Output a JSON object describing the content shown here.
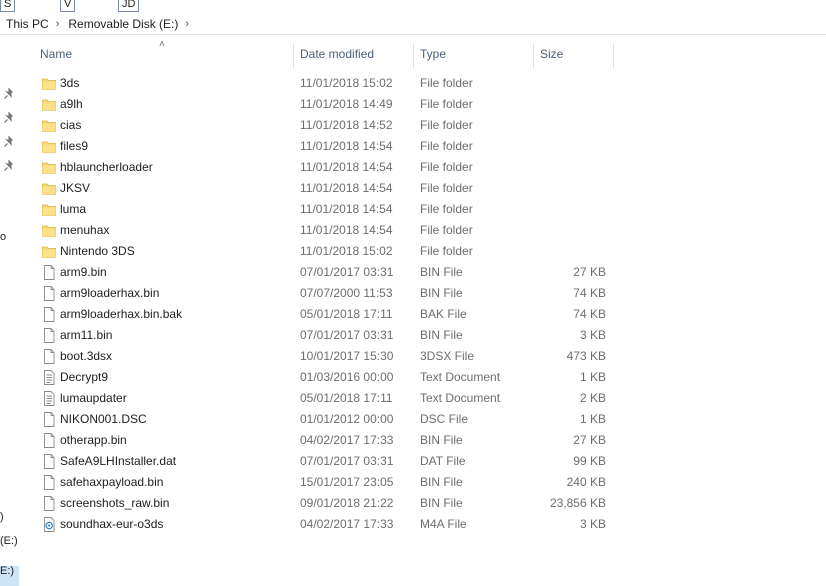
{
  "top_keys": [
    "S",
    "V",
    "JD"
  ],
  "breadcrumb": {
    "items": [
      "This PC",
      "Removable Disk (E:)"
    ]
  },
  "nav_fragments": [
    "o",
    ")",
    "(E:)",
    "E:)"
  ],
  "columns": {
    "name": "Name",
    "date": "Date modified",
    "type": "Type",
    "size": "Size"
  },
  "icons": {
    "folder": "folder-icon",
    "file": "file-icon",
    "text": "text-document-icon",
    "media": "media-file-icon",
    "pin": "pin-icon"
  },
  "colors": {
    "folder": "#f8d775",
    "selection": "#cce4f7",
    "header_text": "#4c607a"
  },
  "files": [
    {
      "name": "3ds",
      "date": "11/01/2018 15:02",
      "type": "File folder",
      "size": "",
      "icon": "folder"
    },
    {
      "name": "a9lh",
      "date": "11/01/2018 14:49",
      "type": "File folder",
      "size": "",
      "icon": "folder"
    },
    {
      "name": "cias",
      "date": "11/01/2018 14:52",
      "type": "File folder",
      "size": "",
      "icon": "folder"
    },
    {
      "name": "files9",
      "date": "11/01/2018 14:54",
      "type": "File folder",
      "size": "",
      "icon": "folder"
    },
    {
      "name": "hblauncherloader",
      "date": "11/01/2018 14:54",
      "type": "File folder",
      "size": "",
      "icon": "folder"
    },
    {
      "name": "JKSV",
      "date": "11/01/2018 14:54",
      "type": "File folder",
      "size": "",
      "icon": "folder"
    },
    {
      "name": "luma",
      "date": "11/01/2018 14:54",
      "type": "File folder",
      "size": "",
      "icon": "folder"
    },
    {
      "name": "menuhax",
      "date": "11/01/2018 14:54",
      "type": "File folder",
      "size": "",
      "icon": "folder"
    },
    {
      "name": "Nintendo 3DS",
      "date": "11/01/2018 15:02",
      "type": "File folder",
      "size": "",
      "icon": "folder"
    },
    {
      "name": "arm9.bin",
      "date": "07/01/2017 03:31",
      "type": "BIN File",
      "size": "27 KB",
      "icon": "file"
    },
    {
      "name": "arm9loaderhax.bin",
      "date": "07/07/2000 11:53",
      "type": "BIN File",
      "size": "74 KB",
      "icon": "file"
    },
    {
      "name": "arm9loaderhax.bin.bak",
      "date": "05/01/2018 17:11",
      "type": "BAK File",
      "size": "74 KB",
      "icon": "file"
    },
    {
      "name": "arm11.bin",
      "date": "07/01/2017 03:31",
      "type": "BIN File",
      "size": "3 KB",
      "icon": "file"
    },
    {
      "name": "boot.3dsx",
      "date": "10/01/2017 15:30",
      "type": "3DSX File",
      "size": "473 KB",
      "icon": "file"
    },
    {
      "name": "Decrypt9",
      "date": "01/03/2016 00:00",
      "type": "Text Document",
      "size": "1 KB",
      "icon": "text"
    },
    {
      "name": "lumaupdater",
      "date": "05/01/2018 17:11",
      "type": "Text Document",
      "size": "2 KB",
      "icon": "text"
    },
    {
      "name": "NIKON001.DSC",
      "date": "01/01/2012 00:00",
      "type": "DSC File",
      "size": "1 KB",
      "icon": "file"
    },
    {
      "name": "otherapp.bin",
      "date": "04/02/2017 17:33",
      "type": "BIN File",
      "size": "27 KB",
      "icon": "file"
    },
    {
      "name": "SafeA9LHInstaller.dat",
      "date": "07/01/2017 03:31",
      "type": "DAT File",
      "size": "99 KB",
      "icon": "file"
    },
    {
      "name": "safehaxpayload.bin",
      "date": "15/01/2017 23:05",
      "type": "BIN File",
      "size": "240 KB",
      "icon": "file"
    },
    {
      "name": "screenshots_raw.bin",
      "date": "09/01/2018 21:22",
      "type": "BIN File",
      "size": "23,856 KB",
      "icon": "file"
    },
    {
      "name": "soundhax-eur-o3ds",
      "date": "04/02/2017 17:33",
      "type": "M4A File",
      "size": "3 KB",
      "icon": "media"
    }
  ]
}
